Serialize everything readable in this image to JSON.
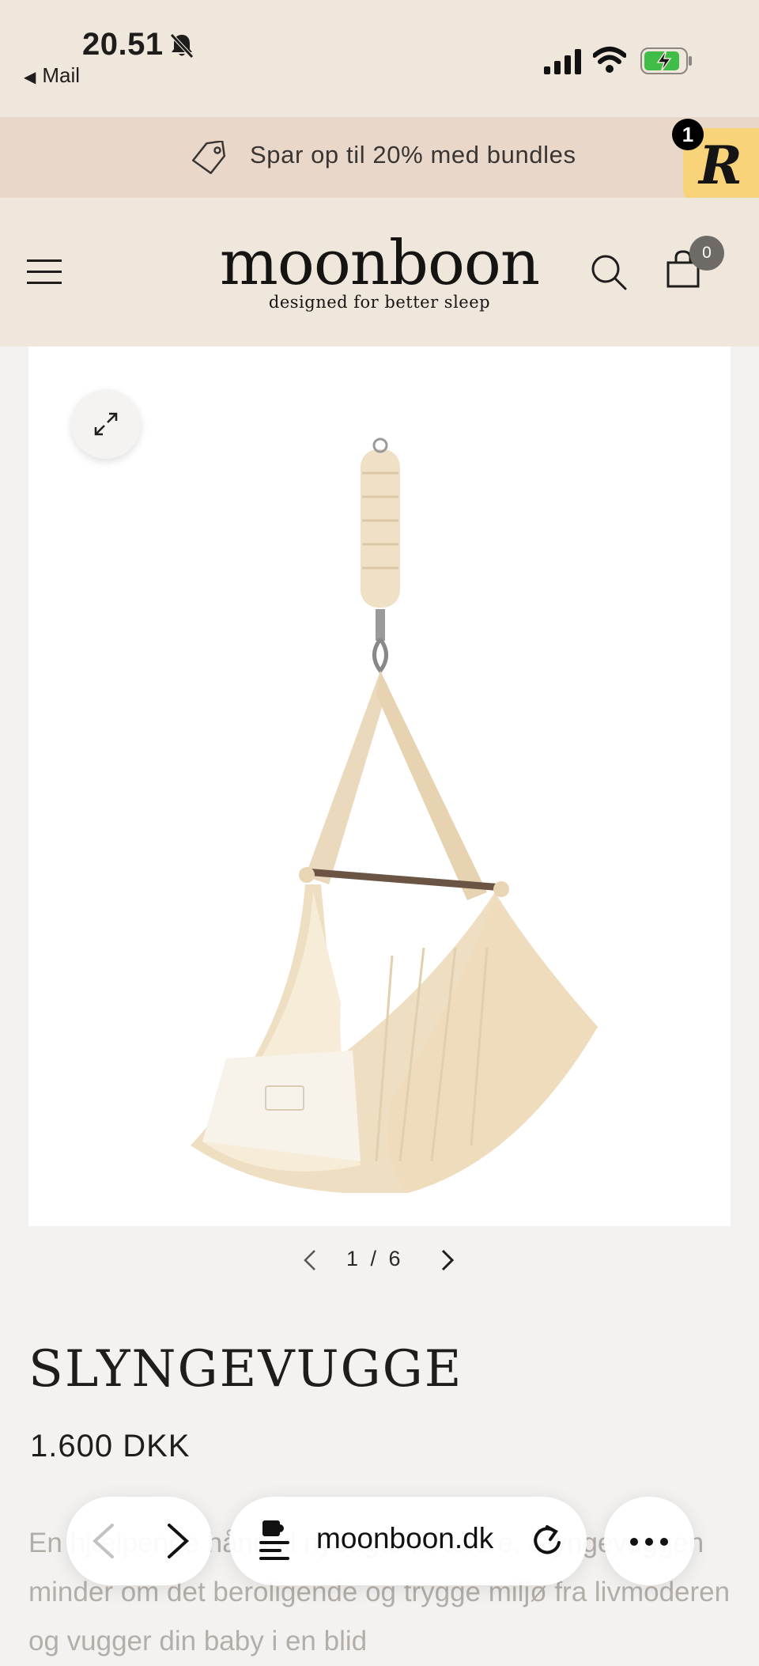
{
  "status_bar": {
    "time": "20.51",
    "back_app": "Mail"
  },
  "promo": {
    "text": "Spar op til 20% med bundles",
    "badge_count": "1",
    "badge_letter": "R"
  },
  "header": {
    "logo": "moonboon",
    "tagline": "designed for better sleep",
    "cart_count": "0"
  },
  "gallery": {
    "current": "1",
    "total": "6",
    "counter": "1 / 6"
  },
  "product": {
    "title": "SLYNGEVUGGE",
    "price": "1.600 DKK",
    "description": "En hjælpende hånd til nybagte forældre. Slyngevuggen minder om det beroligende og trygge miljø fra livmoderen og vugger din baby i en blid"
  },
  "browser": {
    "url": "moonboon.dk"
  },
  "colors": {
    "header_bg": "#efe6dc",
    "promo_bg": "#e9d8c9",
    "badge_bg": "#f8d37a",
    "page_bg": "#f3f2f0"
  },
  "icons": [
    "bell-off-icon",
    "signal-icon",
    "wifi-icon",
    "battery-icon",
    "tag-icon",
    "menu-icon",
    "search-icon",
    "cart-icon",
    "expand-icon",
    "chevron-left-icon",
    "chevron-right-icon",
    "extension-icon",
    "reload-icon",
    "more-icon"
  ]
}
